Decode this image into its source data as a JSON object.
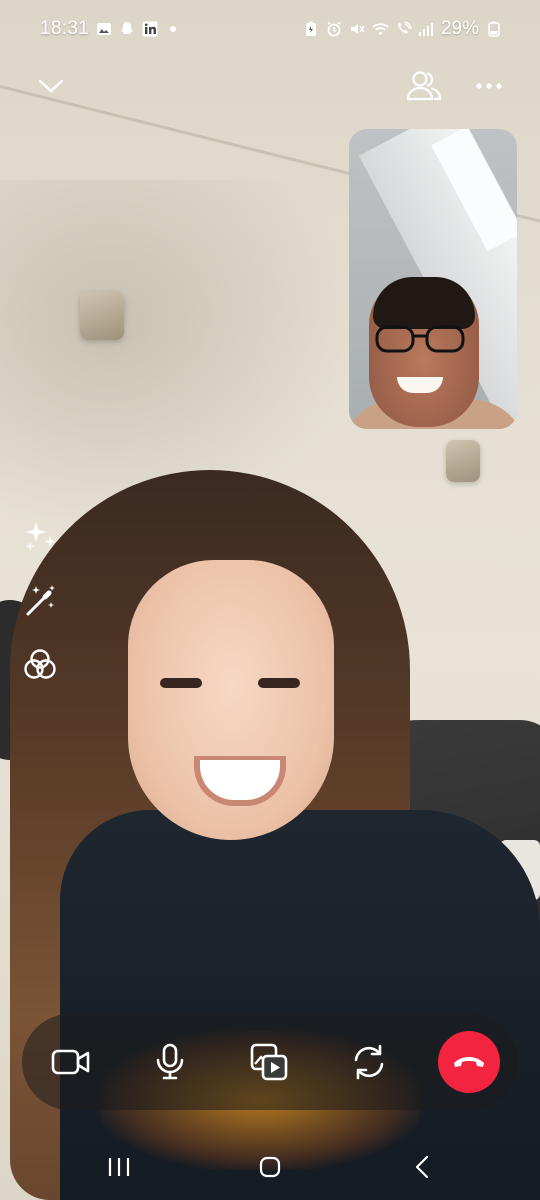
{
  "status_bar": {
    "time": "18:31",
    "battery": "29%",
    "left_icons": [
      "gallery-icon",
      "snapchat-icon",
      "linkedin-icon",
      "dot-icon"
    ],
    "right_icons": [
      "battery-saver-icon",
      "alarm-icon",
      "mute-icon",
      "wifi-icon",
      "wifi-call-icon",
      "signal-icon",
      "battery-charging-icon"
    ]
  },
  "top_controls": {
    "minimize_icon": "chevron-down-icon",
    "participants_icon": "people-icon",
    "more_icon": "more-dots-icon"
  },
  "effects": [
    {
      "name": "sparkles-effect-button",
      "icon": "sparkles-icon"
    },
    {
      "name": "magic-wand-button",
      "icon": "magic-wand-icon"
    },
    {
      "name": "filters-button",
      "icon": "filters-icon"
    }
  ],
  "call_controls": [
    {
      "name": "video-toggle-button",
      "icon": "video-camera-icon"
    },
    {
      "name": "microphone-button",
      "icon": "microphone-icon"
    },
    {
      "name": "share-media-button",
      "icon": "media-share-icon"
    },
    {
      "name": "flip-camera-button",
      "icon": "flip-camera-icon"
    },
    {
      "name": "end-call-button",
      "icon": "hang-up-icon"
    }
  ],
  "colors": {
    "end_call": "#f3243f",
    "control_bar": "#1c1c1c"
  },
  "nav_bar": {
    "recents_icon": "recents-icon",
    "home_icon": "home-icon",
    "back_icon": "back-icon"
  }
}
